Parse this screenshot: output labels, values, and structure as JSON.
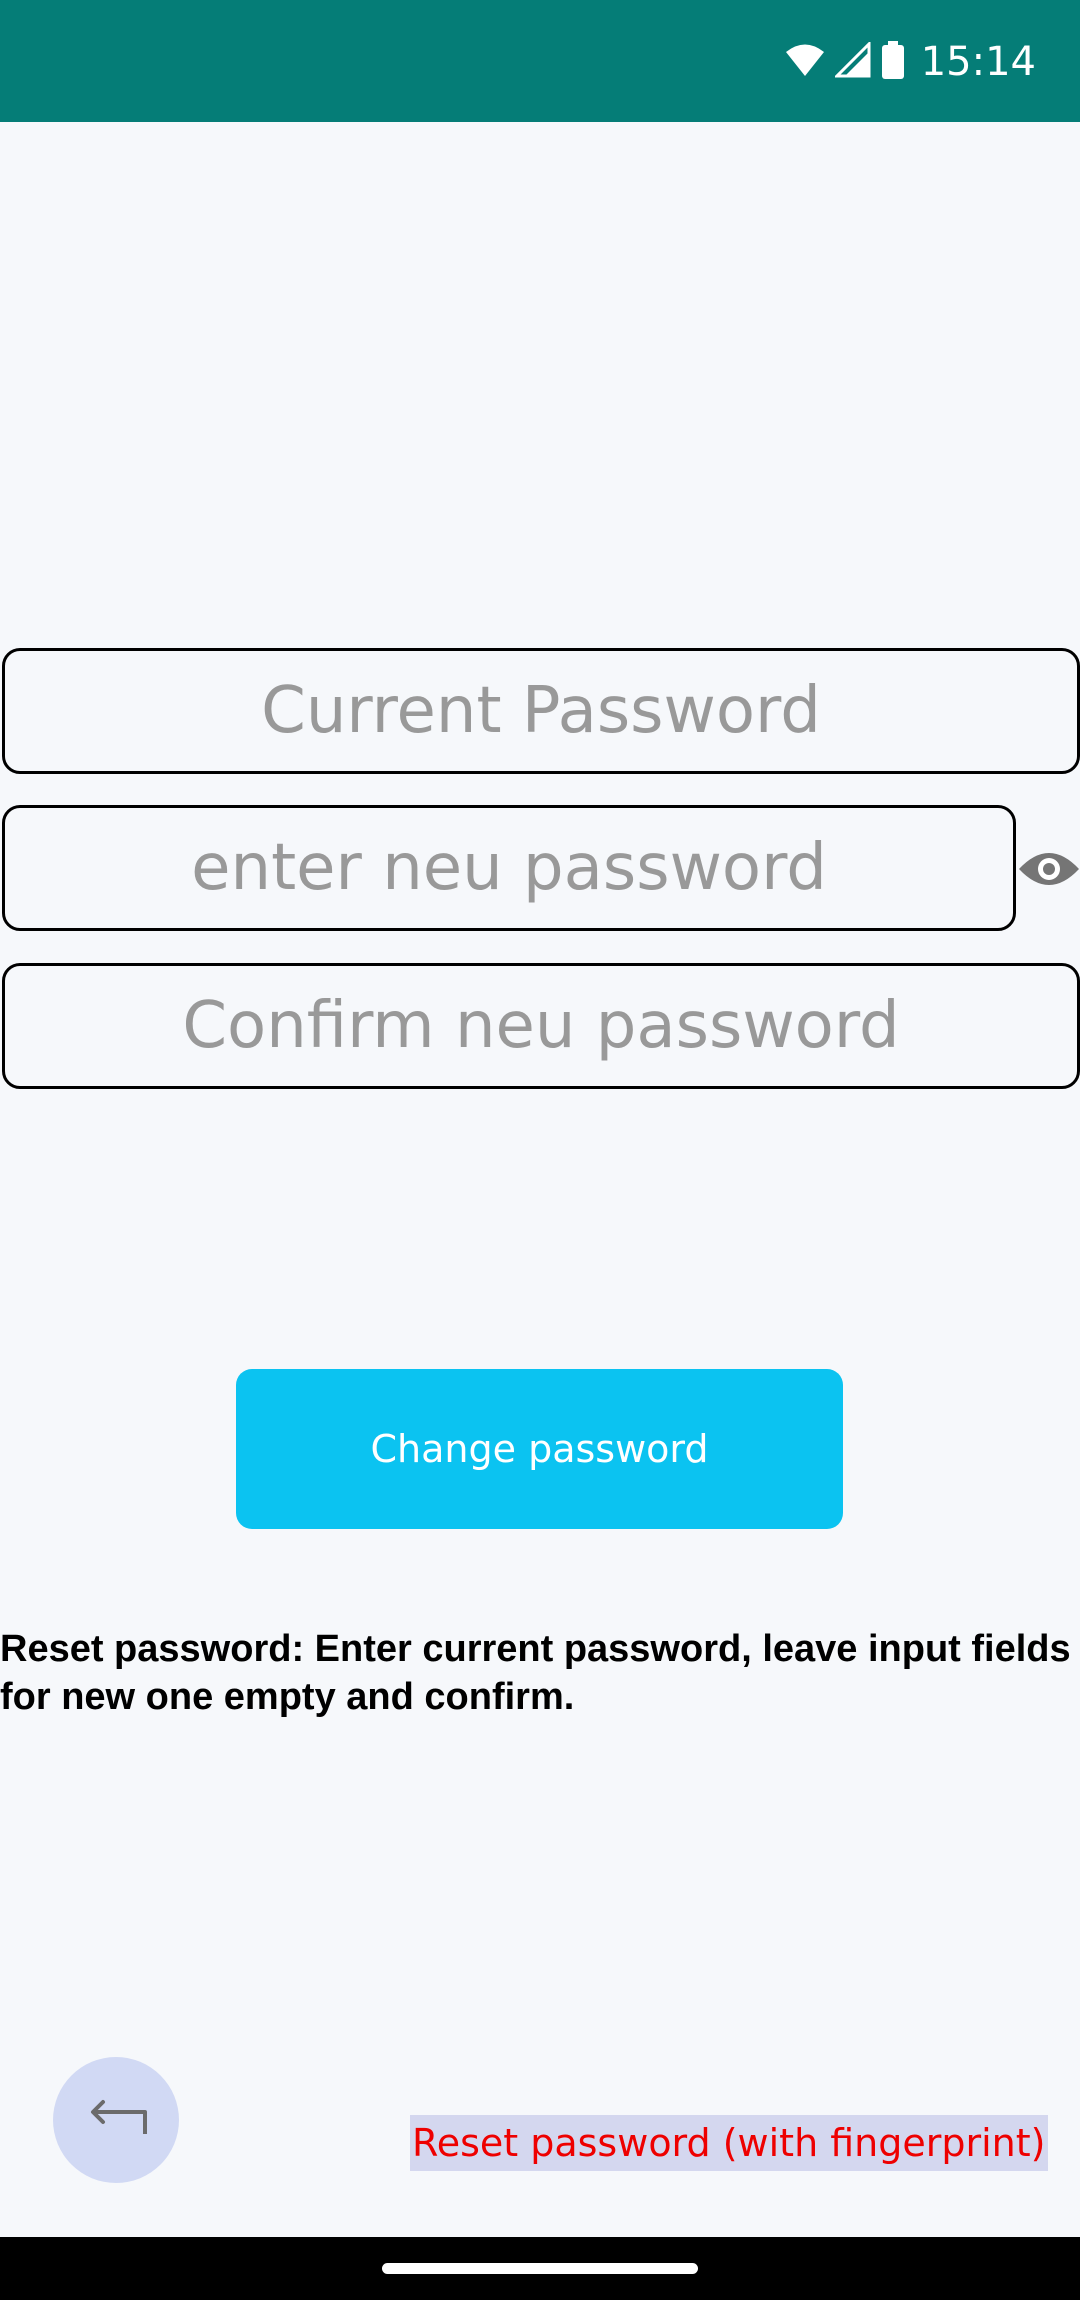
{
  "status_bar": {
    "time": "15:14",
    "icons": [
      "wifi-icon",
      "cell-signal-icon",
      "battery-icon"
    ]
  },
  "form": {
    "current_password_placeholder": "Current Password",
    "new_password_placeholder": "enter neu password",
    "confirm_password_placeholder": "Confirm neu password",
    "toggle_visibility_icon": "eye-icon"
  },
  "actions": {
    "change_password_label": "Change password",
    "back_icon": "back-arrow-icon",
    "reset_fingerprint_label": "Reset password (with fingerprint)"
  },
  "hint": {
    "text": "Reset password: Enter current password, leave input fields for new one empty and confirm."
  },
  "colors": {
    "status_bar": "#057d77",
    "background": "#f6f8fb",
    "primary_button": "#0bc3f1",
    "fingerprint_link_text": "#ee0000",
    "fingerprint_link_highlight": "#d4d7ef",
    "back_button": "#d1d9f4"
  }
}
